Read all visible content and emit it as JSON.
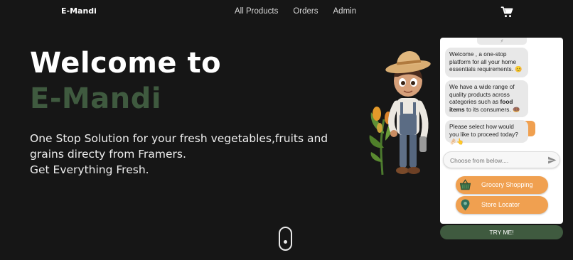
{
  "nav": {
    "brand": "E-Mandi",
    "links": [
      "All Products",
      "Orders",
      "Admin"
    ],
    "cart_icon": "shopping-cart-icon"
  },
  "hero": {
    "title_line1": "Welcome to",
    "title_line2": "E-Mandi",
    "subtitle_lines": [
      "One Stop Solution for your fresh vegetables,fruits and",
      "grains directy from Framers.",
      "Get Everything Fresh."
    ]
  },
  "chat": {
    "messages": [
      {
        "text": "Welcome , a one-stop platform for all your home essentials requirements. 😊"
      },
      {
        "pre": "We have a wide range of quality products across categories such as ",
        "bold": "food items",
        "post": " to its consumers. 🍩"
      },
      {
        "text": "Please select how would you like to proceed today? 🤌🏻👆"
      }
    ],
    "input_placeholder": "Choose from below....",
    "options": [
      {
        "label": "Grocery Shopping",
        "icon": "basket-icon"
      },
      {
        "label": "Store Locator",
        "icon": "map-pin-icon"
      }
    ],
    "try_button": "TRY ME!"
  },
  "colors": {
    "background": "#161616",
    "brand_green": "#3f5a3f",
    "accent_orange": "#f0a050"
  }
}
